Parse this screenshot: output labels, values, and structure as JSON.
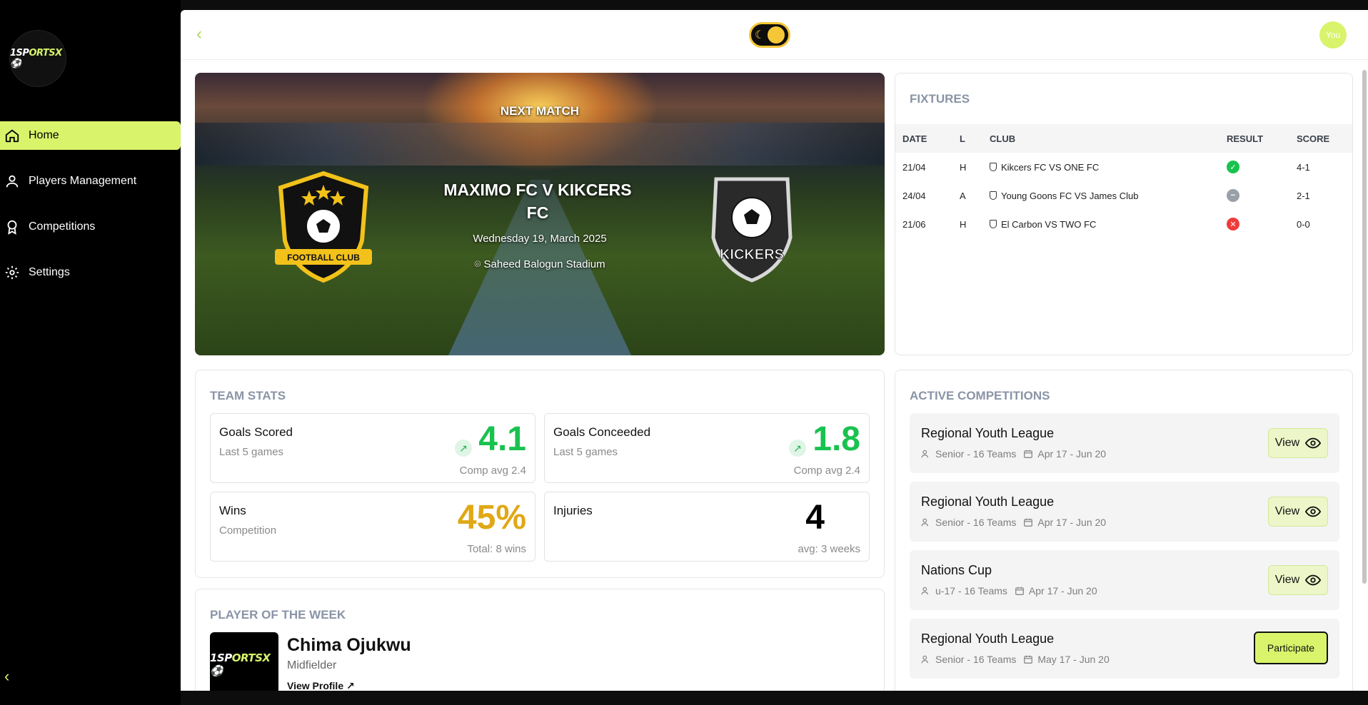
{
  "brand": {
    "logo_text_a": "1SP",
    "logo_text_b": "ORTSX",
    "accent": "#d9f36b"
  },
  "sidebar": {
    "items": [
      {
        "label": "Home",
        "icon": "home-icon",
        "active": true
      },
      {
        "label": "Players Management",
        "icon": "user-icon"
      },
      {
        "label": "Competitions",
        "icon": "award-icon"
      },
      {
        "label": "Settings",
        "icon": "gear-icon"
      }
    ]
  },
  "header": {
    "avatar_label": "You"
  },
  "next_match": {
    "label": "NEXT MATCH",
    "title": "MAXIMO FC V KIKCERS FC",
    "date": "Wednesday 19, March 2025",
    "venue": "Saheed Balogun Stadium",
    "home_crest_text": "FOOTBALL CLUB",
    "away_crest_text": "KICKERS"
  },
  "fixtures": {
    "title": "FIXTURES",
    "columns": [
      "DATE",
      "L",
      "CLUB",
      "RESULT",
      "SCORE"
    ],
    "rows": [
      {
        "date": "21/04",
        "loc": "H",
        "club": "Kikcers FC VS ONE FC",
        "result": "win",
        "score": "4-1"
      },
      {
        "date": "24/04",
        "loc": "A",
        "club": "Young Goons FC VS James Club",
        "result": "draw",
        "score": "2-1"
      },
      {
        "date": "21/06",
        "loc": "H",
        "club": "El Carbon VS TWO FC",
        "result": "loss",
        "score": "0-0"
      }
    ]
  },
  "team_stats": {
    "title": "TEAM STATS",
    "cards": [
      {
        "label": "Goals Scored",
        "sub": "Last 5 games",
        "value": "4.1",
        "foot": "Comp avg 2.4",
        "color": "#19c24f",
        "trend": true
      },
      {
        "label": "Goals Conceeded",
        "sub": "Last 5 games",
        "value": "1.8",
        "foot": "Comp avg 2.4",
        "color": "#19c24f",
        "trend": true
      },
      {
        "label": "Wins",
        "sub": "Competition",
        "value": "45%",
        "foot": "Total: 8 wins",
        "color": "#e0a815",
        "trend": false
      },
      {
        "label": "Injuries",
        "sub": "",
        "value": "4",
        "foot": "avg: 3 weeks",
        "color": "#000000",
        "trend": false
      }
    ]
  },
  "player_of_week": {
    "title": "PLAYER OF THE WEEK",
    "name": "Chima Ojukwu",
    "position": "Midfielder",
    "link": "View Profile"
  },
  "competitions": {
    "title": "ACTIVE COMPETITIONS",
    "items": [
      {
        "name": "Regional Youth League",
        "teams": "Senior - 16 Teams",
        "dates": "Apr 17 - Jun 20",
        "action": "View"
      },
      {
        "name": "Regional Youth League",
        "teams": "Senior - 16 Teams",
        "dates": "Apr 17 - Jun 20",
        "action": "View"
      },
      {
        "name": "Nations Cup",
        "teams": "u-17 - 16 Teams",
        "dates": "Apr 17 - Jun 20",
        "action": "View"
      },
      {
        "name": "Regional Youth League",
        "teams": "Senior - 16 Teams",
        "dates": "May 17 - Jun 20",
        "action": "Participate"
      }
    ]
  }
}
